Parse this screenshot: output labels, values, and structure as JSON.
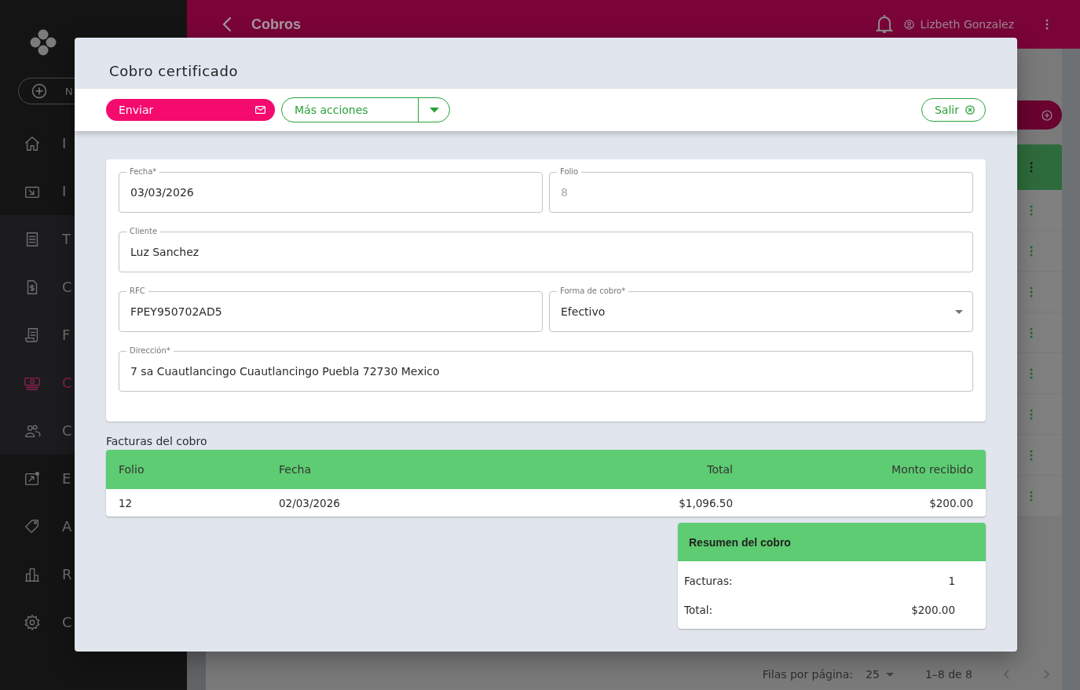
{
  "sidebar": {
    "new_button": "N",
    "sections": [
      {
        "highlighted": false,
        "items": [
          {
            "label": "I",
            "selected": false
          },
          {
            "label": "I",
            "selected": false
          }
        ]
      },
      {
        "highlighted": true,
        "items": [
          {
            "label": "T",
            "selected": false
          },
          {
            "label": "C",
            "selected": false
          },
          {
            "label": "F",
            "selected": false
          },
          {
            "label": "C",
            "selected": true
          },
          {
            "label": "C",
            "selected": false
          }
        ]
      },
      {
        "highlighted": false,
        "items": [
          {
            "label": "E",
            "selected": false
          },
          {
            "label": "A",
            "selected": false
          },
          {
            "label": "R",
            "selected": false
          },
          {
            "label": "C",
            "selected": false
          }
        ]
      }
    ]
  },
  "header": {
    "title": "Cobros",
    "user": "Lizbeth Gonzalez"
  },
  "pagination": {
    "rows_per_page_label": "Filas por página:",
    "rows_per_page": "25",
    "range": "1–8 de 8"
  },
  "dialog": {
    "title": "Cobro certificado",
    "actions": [
      {
        "kind": "primary",
        "label": "Enviar"
      },
      {
        "kind": "split",
        "label": "Más acciones"
      },
      {
        "kind": "exit",
        "label": "Salir"
      }
    ],
    "form": [
      [
        {
          "kind": "text",
          "label": "Fecha*",
          "value": "03/03/2026",
          "disabled": false
        },
        {
          "kind": "text",
          "label": "Folio",
          "value": "8",
          "disabled": true
        }
      ],
      [
        {
          "kind": "text",
          "label": "Cliente",
          "value": "Luz Sanchez",
          "disabled": false
        }
      ],
      [
        {
          "kind": "text",
          "label": "RFC",
          "value": "FPEY950702AD5",
          "disabled": false
        },
        {
          "kind": "select",
          "label": "Forma de cobro*",
          "value": "Efectivo",
          "disabled": false
        }
      ],
      [
        {
          "kind": "text",
          "label": "Dirección*",
          "value": "7 sa Cuautlancingo Cuautlancingo Puebla 72730 Mexico",
          "disabled": false
        }
      ]
    ],
    "invoices": {
      "title": "Facturas del cobro",
      "columns": [
        "Folio",
        "Fecha",
        "Total",
        "Monto recibido"
      ],
      "rows": [
        [
          "12",
          "02/03/2026",
          "$1,096.50",
          "$200.00"
        ]
      ]
    },
    "summary": {
      "title": "Resumen del cobro",
      "items": [
        {
          "label": "Facturas:",
          "value": "1"
        },
        {
          "label": "Total:",
          "value": "$200.00"
        }
      ]
    }
  }
}
